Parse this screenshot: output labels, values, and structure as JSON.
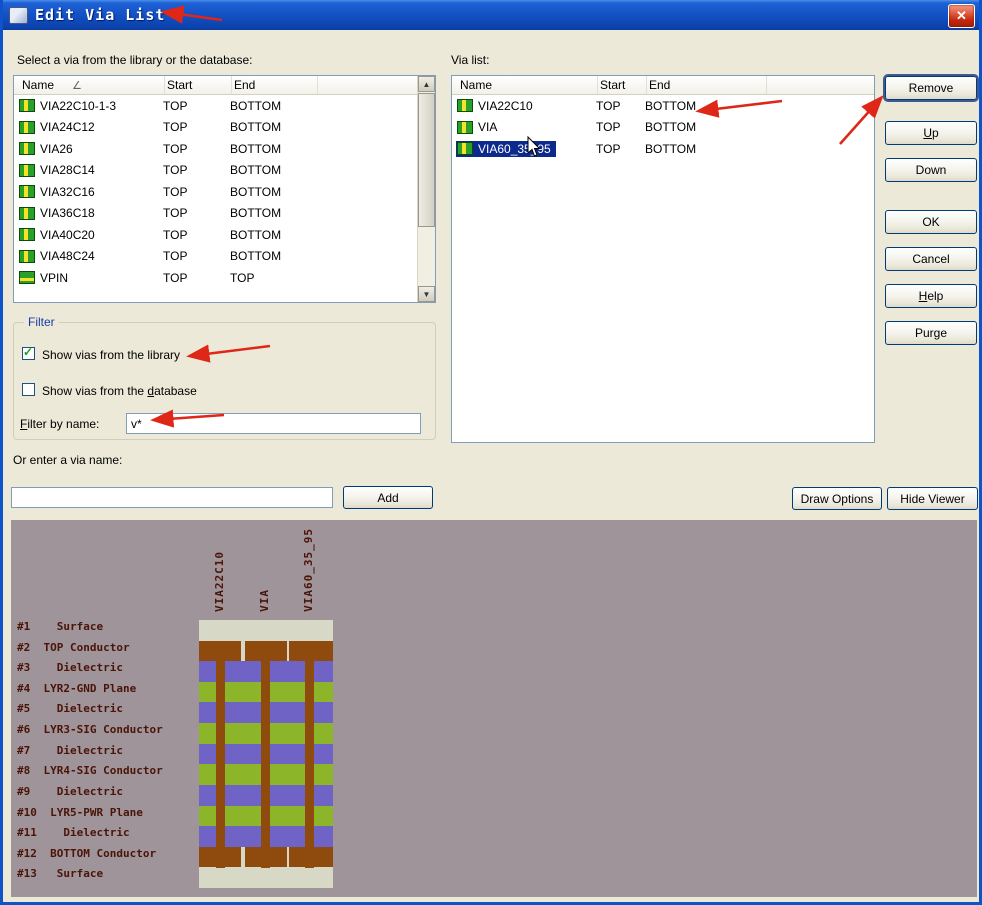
{
  "window": {
    "title": "Edit Via List",
    "close_glyph": "✕"
  },
  "left_panel": {
    "label": "Select a via from the library or the database:",
    "columns": [
      "Name",
      "Start",
      "End"
    ],
    "sort_glyph": "∠",
    "scrollbar": {
      "up_glyph": "▲",
      "down_glyph": "▼"
    },
    "rows": [
      {
        "name": "VIA22C10-1-3",
        "start": "TOP",
        "end": "BOTTOM",
        "icon": "via",
        "selected": false
      },
      {
        "name": "VIA24C12",
        "start": "TOP",
        "end": "BOTTOM",
        "icon": "via",
        "selected": false
      },
      {
        "name": "VIA26",
        "start": "TOP",
        "end": "BOTTOM",
        "icon": "via",
        "selected": false
      },
      {
        "name": "VIA28C14",
        "start": "TOP",
        "end": "BOTTOM",
        "icon": "via",
        "selected": false
      },
      {
        "name": "VIA32C16",
        "start": "TOP",
        "end": "BOTTOM",
        "icon": "via",
        "selected": false
      },
      {
        "name": "VIA36C18",
        "start": "TOP",
        "end": "BOTTOM",
        "icon": "via",
        "selected": false
      },
      {
        "name": "VIA40C20",
        "start": "TOP",
        "end": "BOTTOM",
        "icon": "via",
        "selected": false
      },
      {
        "name": "VIA48C24",
        "start": "TOP",
        "end": "BOTTOM",
        "icon": "via",
        "selected": false
      },
      {
        "name": "VPIN",
        "start": "TOP",
        "end": "TOP",
        "icon": "vpin",
        "selected": false
      }
    ]
  },
  "right_panel": {
    "label": "Via list:",
    "columns": [
      "Name",
      "Start",
      "End"
    ],
    "rows": [
      {
        "name": "VIA22C10",
        "start": "TOP",
        "end": "BOTTOM",
        "icon": "via",
        "selected": false
      },
      {
        "name": "VIA",
        "start": "TOP",
        "end": "BOTTOM",
        "icon": "via",
        "selected": false
      },
      {
        "name": "VIA60_35_95",
        "start": "TOP",
        "end": "BOTTOM",
        "icon": "via",
        "selected": true
      }
    ]
  },
  "buttons": {
    "remove": "Remove",
    "up": "Up",
    "up_mnemonic": "U",
    "down": "Down",
    "ok": "OK",
    "cancel": "Cancel",
    "help": "Help",
    "help_mnemonic": "H",
    "purge": "Purge",
    "add": "Add",
    "draw_options": "Draw Options",
    "hide_viewer": "Hide Viewer"
  },
  "filter": {
    "legend": "Filter",
    "library_label": "Show vias from the library",
    "library_checked": true,
    "database_label": "Show vias from the database",
    "database_checked": false,
    "database_mnemonic": "d",
    "name_label": "Filter by name:",
    "name_mnemonic": "F",
    "name_value": "v*",
    "check_glyph": "✓"
  },
  "via_name_entry": {
    "label": "Or enter a via name:",
    "value": ""
  },
  "viewer": {
    "via_labels": [
      "VIA22C10",
      "VIA",
      "VIA60_35_95"
    ],
    "layers": [
      {
        "text": "#1    Surface",
        "type": "surface"
      },
      {
        "text": "#2  TOP Conductor",
        "type": "outer"
      },
      {
        "text": "#3    Dielectric",
        "type": "dielectric"
      },
      {
        "text": "#4  LYR2-GND Plane",
        "type": "plane"
      },
      {
        "text": "#5    Dielectric",
        "type": "dielectric"
      },
      {
        "text": "#6  LYR3-SIG Conductor",
        "type": "plane"
      },
      {
        "text": "#7    Dielectric",
        "type": "dielectric"
      },
      {
        "text": "#8  LYR4-SIG Conductor",
        "type": "plane"
      },
      {
        "text": "#9    Dielectric",
        "type": "dielectric"
      },
      {
        "text": "#10  LYR5-PWR Plane",
        "type": "plane"
      },
      {
        "text": "#11    Dielectric",
        "type": "dielectric"
      },
      {
        "text": "#12  BOTTOM Conductor",
        "type": "outer"
      },
      {
        "text": "#13   Surface",
        "type": "surface"
      }
    ],
    "colors": {
      "background": "#9e949a",
      "surface": "#d8d8c6",
      "conductor": "#8f4a0e",
      "dielectric": "#6f63c6",
      "plane": "#8cb52a",
      "text": "#4b1408"
    }
  },
  "annotations": {
    "arrow_color": "#df2717"
  }
}
